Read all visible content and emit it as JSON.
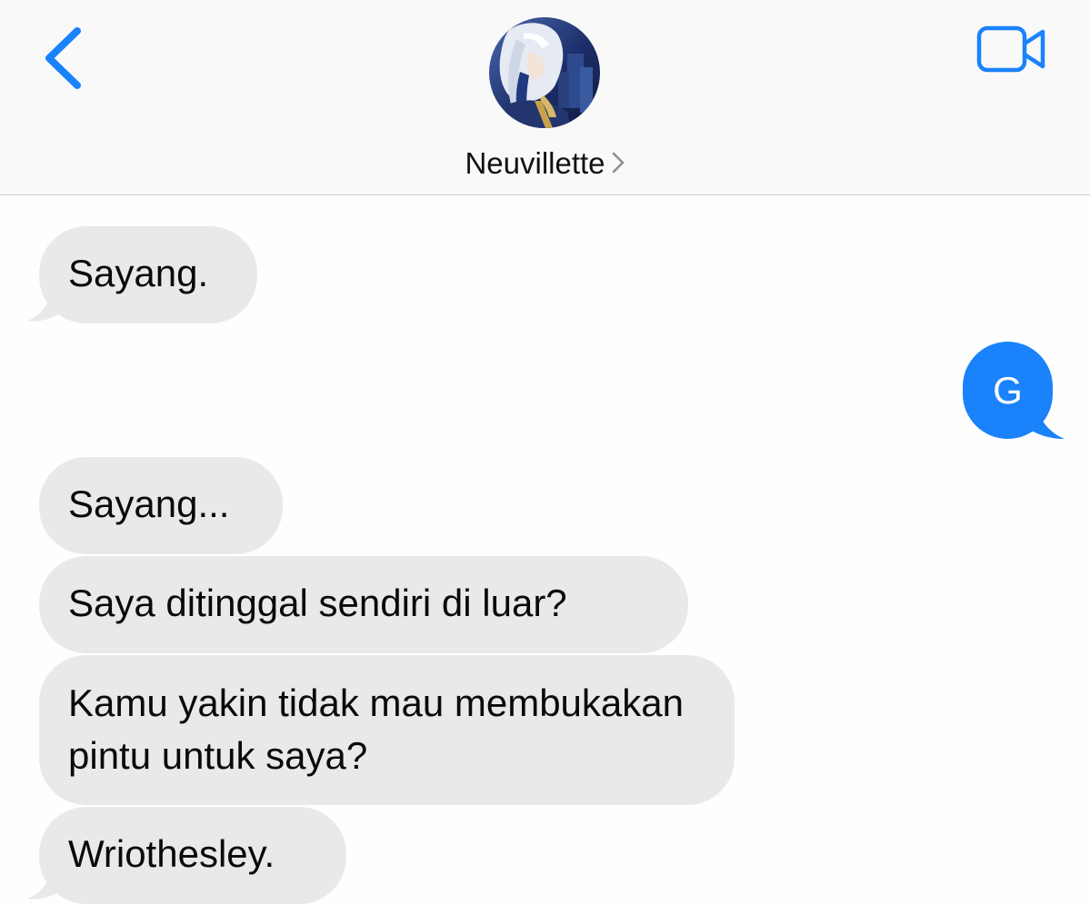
{
  "header": {
    "contact_name": "Neuvillette",
    "back_icon": "chevron-left-icon",
    "video_icon": "video-camera-icon",
    "accent_color": "#1a82fb"
  },
  "messages": [
    {
      "direction": "incoming",
      "text": "Sayang."
    },
    {
      "direction": "outgoing",
      "text": "G"
    },
    {
      "direction": "incoming",
      "text": "Sayang..."
    },
    {
      "direction": "incoming",
      "text": "Saya ditinggal sendiri di luar?"
    },
    {
      "direction": "incoming",
      "text": "Kamu yakin tidak mau membukakan pintu untuk saya?"
    },
    {
      "direction": "incoming",
      "text": "Wriothesley."
    }
  ]
}
